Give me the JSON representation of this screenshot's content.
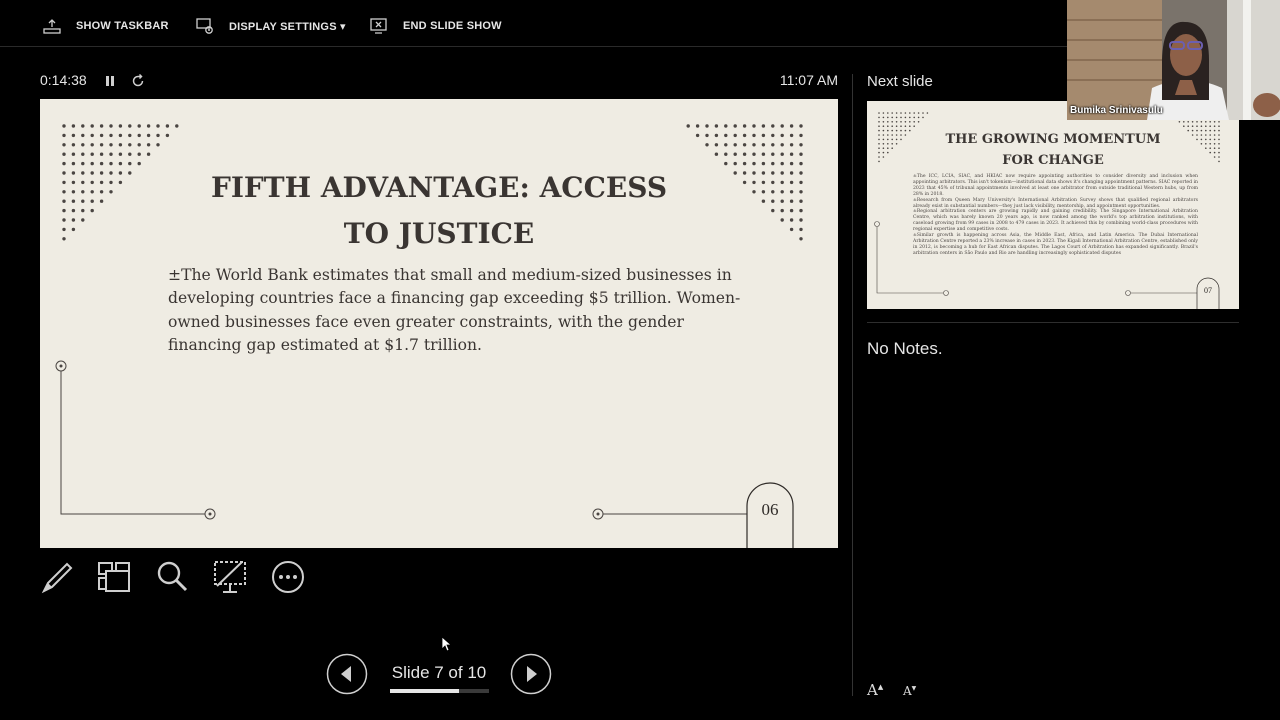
{
  "topbar": {
    "show_taskbar": "SHOW TASKBAR",
    "display_settings": "DISPLAY SETTINGS ▾",
    "end_slide_show": "END SLIDE SHOW"
  },
  "presenter": {
    "timer": "0:14:38",
    "clock": "11:07 AM"
  },
  "current_slide": {
    "title_line1": "FIFTH ADVANTAGE: ACCESS",
    "title_line2": "TO JUSTICE",
    "body": "±The World Bank estimates that small and medium-sized businesses in developing countries face a financing gap exceeding $5 trillion. Women-owned businesses face even greater constraints, with the gender financing gap estimated at $1.7 trillion.",
    "number": "06"
  },
  "tools": [
    "pen-tool",
    "see-all-slides",
    "zoom",
    "black-screen",
    "more-options"
  ],
  "navigation": {
    "counter": "Slide 7 of 10",
    "progress": 0.7
  },
  "next_slide": {
    "label": "Next slide",
    "title_line1": "THE GROWING MOMENTUM",
    "title_line2": "FOR CHANGE",
    "paragraphs": [
      "±The ICC, LCIA, SIAC, and HKIAC now require appointing authorities to consider diversity and inclusion when appointing arbitrators. This isn't tokenism—institutional data shows it's changing appointment patterns. SIAC reported in 2023 that 45% of tribunal appointments involved at least one arbitrator from outside traditional Western hubs, up from 28% in 2018.",
      "±Research from Queen Mary University's International Arbitration Survey shows that qualified regional arbitrators already exist in substantial numbers—they just lack visibility, mentorship, and appointment opportunities.",
      "±Regional arbitration centers are growing rapidly and gaining credibility. The Singapore International Arbitration Centre, which was barely known 20 years ago, is now ranked among the world's top arbitration institutions, with caseload growing from 99 cases in 2008 to 479 cases in 2023. It achieved this by combining world-class procedures with regional expertise and competitive costs.",
      "±Similar growth is happening across Asia, the Middle East, Africa, and Latin America. The Dubai International Arbitration Centre reported a 23% increase in cases in 2023. The Kigali International Arbitration Centre, established only in 2012, is becoming a hub for East African disputes. The Lagos Court of Arbitration has expanded significantly. Brazil's arbitration centers in São Paulo and Rio are handling increasingly sophisticated disputes"
    ],
    "number": "07"
  },
  "notes": "No Notes.",
  "font_controls": {
    "increase": "A",
    "decrease": "A"
  },
  "webcam": {
    "participant_name": "Bumika Srinivasulu"
  },
  "colors": {
    "background": "#000000",
    "slide_background": "#efece3",
    "slide_text": "#3a3532"
  }
}
